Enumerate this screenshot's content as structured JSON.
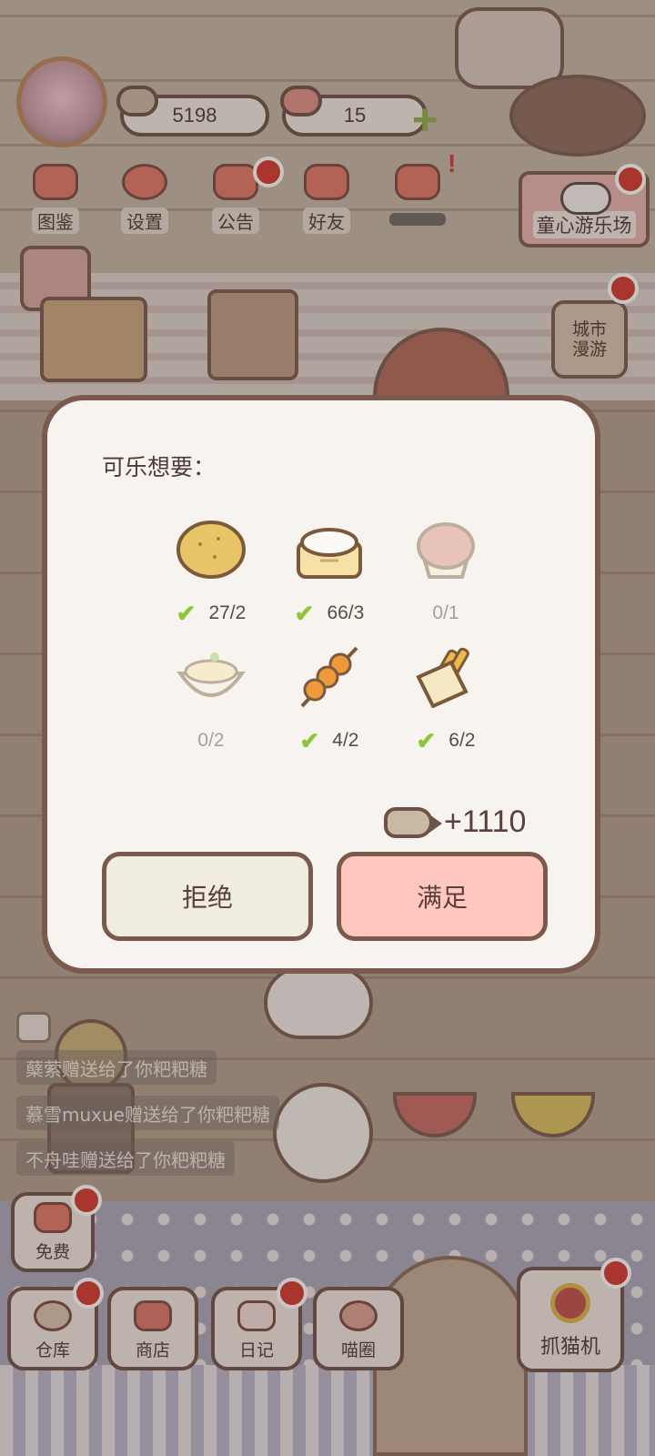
{
  "hud": {
    "coins": "5198",
    "hearts": "15",
    "plus_icon": "plus-icon"
  },
  "menu": [
    {
      "label": "图鉴",
      "icon": "cat-book-icon"
    },
    {
      "label": "设置",
      "icon": "gear-icon"
    },
    {
      "label": "公告",
      "icon": "gift-icon"
    },
    {
      "label": "好友",
      "icon": "friends-icon"
    },
    {
      "label": "",
      "icon": "heart-mail-icon"
    }
  ],
  "side": {
    "park": "童心游乐场",
    "city_line1": "城市",
    "city_line2": "漫游"
  },
  "dialog": {
    "title": "可乐想要：",
    "items": [
      {
        "name": "potato",
        "progress": "27/2",
        "met": true
      },
      {
        "name": "steamed-bun",
        "progress": "66/3",
        "met": true
      },
      {
        "name": "muffin",
        "progress": "0/1",
        "met": false
      },
      {
        "name": "rice-bowl",
        "progress": "0/2",
        "met": false
      },
      {
        "name": "fishball-skewer",
        "progress": "4/2",
        "met": true
      },
      {
        "name": "fries",
        "progress": "6/2",
        "met": true
      }
    ],
    "reward": "+1110",
    "reject": "拒绝",
    "accept": "满足"
  },
  "chat": [
    "蘖萦赠送给了你粑粑糖",
    "慕雪muxue赠送给了你粑粑糖",
    "不舟哇赠送给了你粑粑糖"
  ],
  "bottom": {
    "free": "免费",
    "warehouse": "仓库",
    "shop": "商店",
    "diary": "日记",
    "meow_circle": "喵圈",
    "claw_machine": "抓猫机"
  },
  "colors": {
    "accept_bg": "#ffc7be",
    "reject_bg": "#f1ece0",
    "check": "#8fc43e",
    "badge": "#d23a32"
  }
}
